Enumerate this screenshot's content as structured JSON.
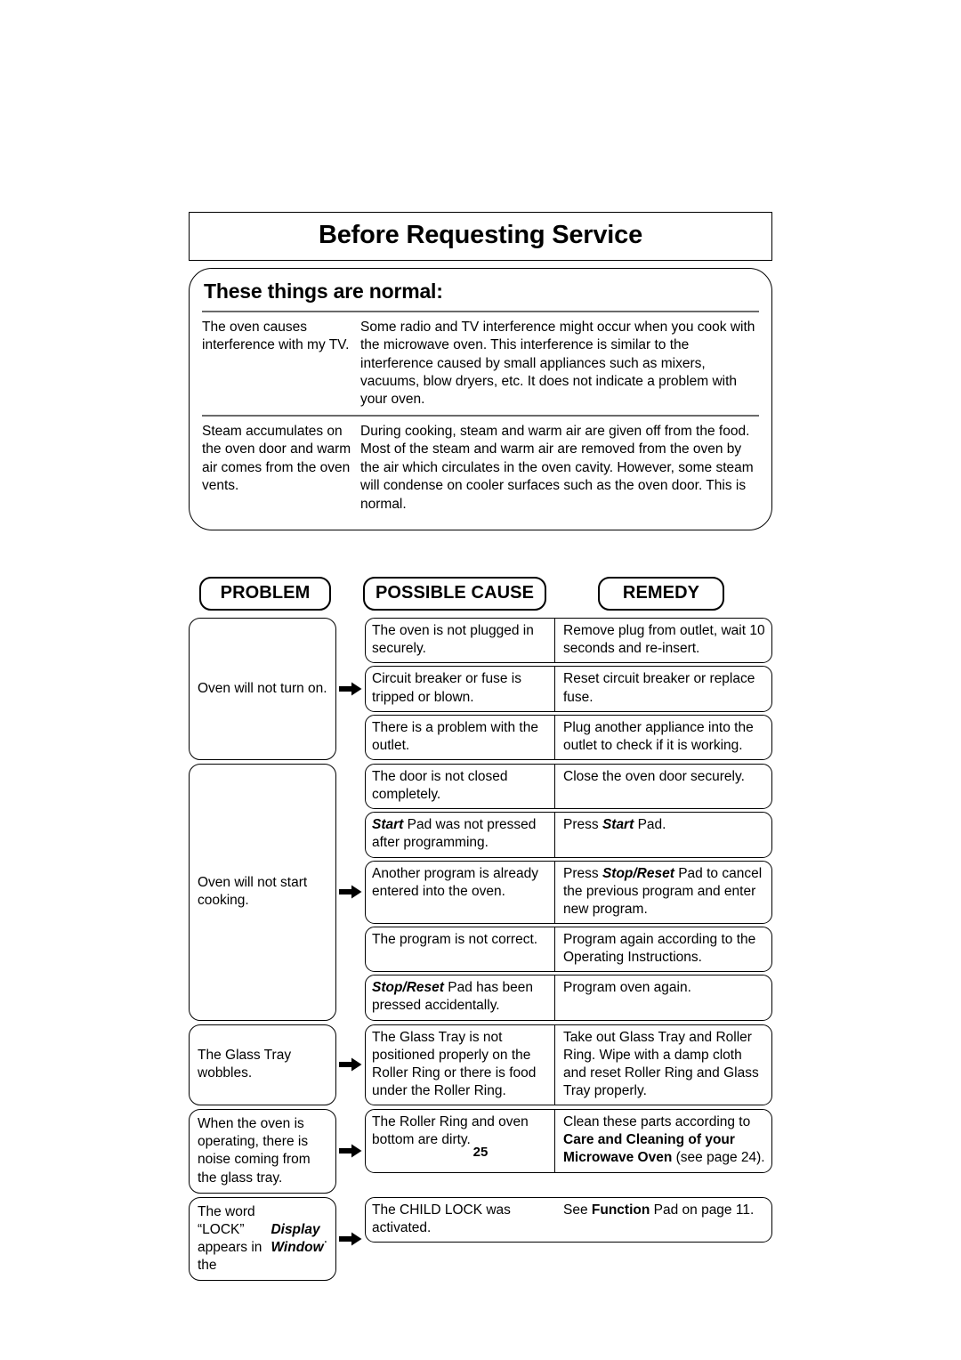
{
  "document": {
    "chapter_title": "Before Requesting Service",
    "page_number": "25"
  },
  "normal_section": {
    "heading": "These things are normal:",
    "rows": [
      {
        "question": "The oven causes interference with my TV.",
        "answer": "Some radio and TV interference might occur when you cook with the microwave oven. This interference is similar to the interference caused by small appliances such as mixers, vacuums, blow dryers, etc. It does not indicate a problem with your oven."
      },
      {
        "question": "Steam accumulates on the oven door and warm air comes from the oven vents.",
        "answer": "During cooking, steam and warm air are given off from the food. Most of the steam and warm air are removed from the oven by the air which circulates in the oven cavity. However, some steam will condense on cooler surfaces such as the oven door. This is normal."
      }
    ]
  },
  "troubleshooting": {
    "headers": {
      "problem": "PROBLEM",
      "possible_cause": "POSSIBLE CAUSE",
      "remedy": "REMEDY"
    },
    "groups": [
      {
        "problem": "Oven will not turn on.",
        "rows": [
          {
            "cause": "The oven is not plugged in securely.",
            "remedy": "Remove plug from outlet, wait 10 seconds and re-insert."
          },
          {
            "cause": "Circuit breaker or fuse is tripped or blown.",
            "remedy": "Reset circuit breaker or replace fuse."
          },
          {
            "cause": "There is a problem with the outlet.",
            "remedy": "Plug another appliance into the outlet to check if it is working."
          }
        ]
      },
      {
        "problem": "Oven will not start cooking.",
        "rows": [
          {
            "cause": "The door is not closed completely.",
            "remedy": "Close the oven door securely."
          },
          {
            "cause_rich": [
              {
                "text": "Start",
                "style": "bold-italic"
              },
              {
                "text": " Pad was not pressed after programming.",
                "style": "normal"
              }
            ],
            "remedy_rich": [
              {
                "text": "Press ",
                "style": "normal"
              },
              {
                "text": "Start",
                "style": "bold-italic"
              },
              {
                "text": " Pad.",
                "style": "normal"
              }
            ]
          },
          {
            "cause": "Another program is already entered into the oven.",
            "remedy_rich": [
              {
                "text": "Press ",
                "style": "normal"
              },
              {
                "text": "Stop/Reset",
                "style": "bold-italic"
              },
              {
                "text": " Pad to cancel the previous program and enter new program.",
                "style": "normal"
              }
            ]
          },
          {
            "cause": "The program is not correct.",
            "remedy": "Program again according to the Operating Instructions."
          },
          {
            "cause_rich": [
              {
                "text": "Stop/Reset",
                "style": "bold-italic"
              },
              {
                "text": " Pad has been pressed accidentally.",
                "style": "normal"
              }
            ],
            "remedy": "Program oven again."
          }
        ]
      },
      {
        "problem": "The Glass Tray wobbles.",
        "rows": [
          {
            "cause": "The Glass Tray is not positioned properly on the Roller Ring or there is food under the Roller Ring.",
            "remedy": "Take out Glass Tray and Roller Ring. Wipe with a damp cloth and reset Roller Ring and Glass Tray properly."
          }
        ]
      },
      {
        "problem": "When the oven is operating, there is noise coming from the glass tray.",
        "rows": [
          {
            "cause": "The Roller Ring and oven bottom are dirty.",
            "remedy_rich": [
              {
                "text": "Clean these parts according to ",
                "style": "normal"
              },
              {
                "text": "Care and Cleaning of your Microwave Oven",
                "style": "bold"
              },
              {
                "text": " (see page 24).",
                "style": "normal"
              }
            ]
          }
        ]
      },
      {
        "problem_rich": [
          {
            "text": "The word “LOCK” appears in the ",
            "style": "normal"
          },
          {
            "text": "Display Window",
            "style": "bold-italic"
          },
          {
            "text": ".",
            "style": "normal"
          }
        ],
        "rows": [
          {
            "cause": "The CHILD LOCK was activated.",
            "remedy_rich": [
              {
                "text": "See ",
                "style": "normal"
              },
              {
                "text": "Function",
                "style": "bold"
              },
              {
                "text": " Pad on page 11.",
                "style": "normal"
              }
            ],
            "no_divider": true
          }
        ]
      }
    ]
  }
}
